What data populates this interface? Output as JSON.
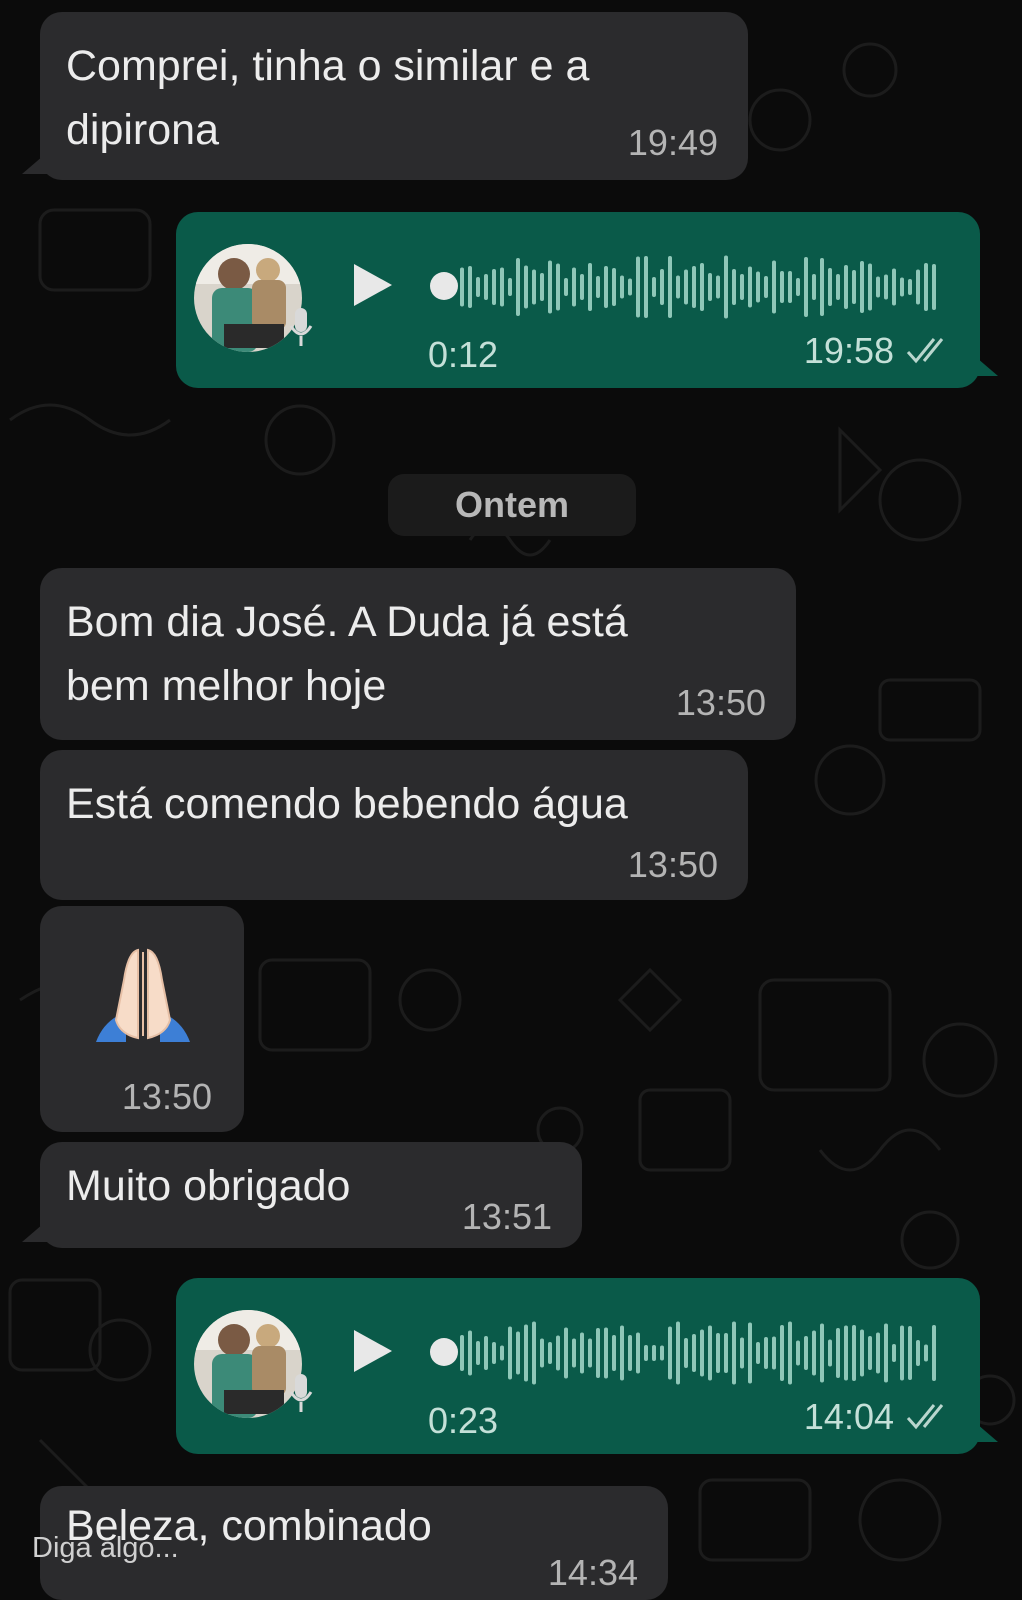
{
  "theme": {
    "incoming_bubble": "#2b2b2d",
    "outgoing_bubble": "#0a5a49",
    "background": "#0b0b0b"
  },
  "messages": [
    {
      "kind": "text",
      "dir": "in",
      "text_lines": [
        "Comprei, tinha o similar e a",
        "dipirona"
      ],
      "time": "19:49"
    },
    {
      "kind": "voice",
      "dir": "out",
      "duration": "0:12",
      "time": "19:58",
      "status": "read-double-check",
      "play_icon": "play-icon"
    },
    {
      "kind": "text",
      "dir": "in",
      "text_lines": [
        "Bom dia José. A Duda já está",
        "bem melhor hoje"
      ],
      "time": "13:50"
    },
    {
      "kind": "text",
      "dir": "in",
      "text_lines": [
        "Está comendo bebendo água"
      ],
      "time": "13:50"
    },
    {
      "kind": "emoji",
      "dir": "in",
      "emoji": "folded-hands",
      "time": "13:50"
    },
    {
      "kind": "text",
      "dir": "in",
      "text_lines": [
        "Muito obrigado"
      ],
      "time": "13:51"
    },
    {
      "kind": "voice",
      "dir": "out",
      "duration": "0:23",
      "time": "14:04",
      "status": "read-double-check",
      "play_icon": "play-icon"
    },
    {
      "kind": "text",
      "dir": "in",
      "text_lines": [
        "Beleza, combinado"
      ],
      "time": "14:34"
    }
  ],
  "date_separator": "Ontem",
  "composer": {
    "placeholder": "Diga algo..."
  }
}
